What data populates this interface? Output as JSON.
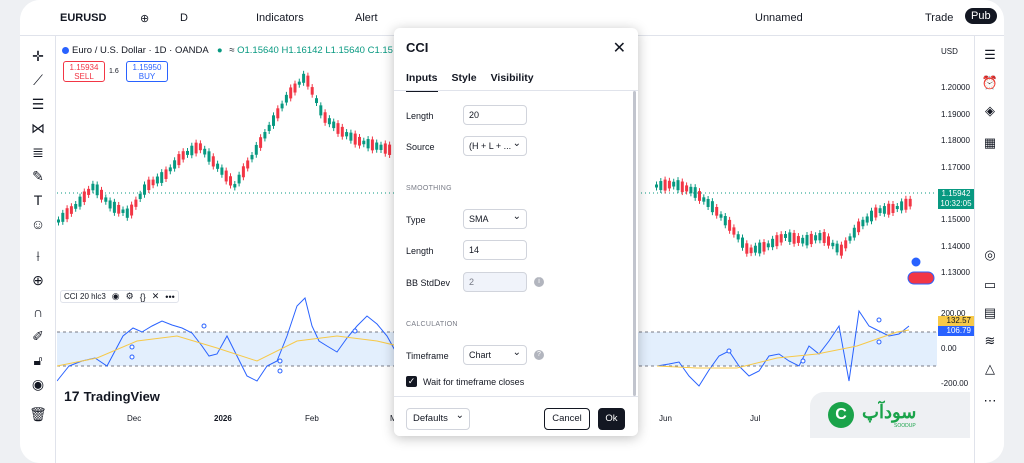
{
  "topbar": {
    "symbol": "EURUSD",
    "interval": "D",
    "indicators_label": "Indicators",
    "alert_label": "Alert",
    "layout_label": "Unnamed",
    "trade_label": "Trade",
    "publish_label": "Pub"
  },
  "legend": {
    "title": "Euro / U.S. Dollar · 1D · OANDA",
    "o": "O1.15640",
    "h": "H1.16142",
    "l": "L1.15640",
    "c": "C1.15"
  },
  "trade": {
    "sell_price": "1.15934",
    "sell_label": "SELL",
    "spread": "1.6",
    "buy_price": "1.15950",
    "buy_label": "BUY"
  },
  "price_axis": {
    "currency": "USD",
    "labels": [
      "1.20000",
      "1.19000",
      "1.18000",
      "1.17000",
      "1.15000",
      "1.14000",
      "1.13000"
    ],
    "last_price": "1.15942",
    "countdown": "10:32:05",
    "cci_labels": [
      "200.00",
      "0.00",
      "-200.00"
    ],
    "cci_value1": "132.57",
    "cci_value2": "106.79"
  },
  "time_axis": [
    "Dec",
    "2026",
    "Feb",
    "M",
    "Jun",
    "Jul"
  ],
  "cci_legend": "CCI 20 hlc3",
  "brand": "TradingView",
  "dialog": {
    "title": "CCI",
    "tabs": [
      "Inputs",
      "Style",
      "Visibility"
    ],
    "length_label": "Length",
    "length_value": "20",
    "source_label": "Source",
    "source_value": "(H + L + ...",
    "smoothing_header": "SMOOTHING",
    "type_label": "Type",
    "type_value": "SMA",
    "smooth_length_label": "Length",
    "smooth_length_value": "14",
    "bb_label": "BB StdDev",
    "bb_value": "2",
    "calculation_header": "CALCULATION",
    "timeframe_label": "Timeframe",
    "timeframe_value": "Chart",
    "wait_label": "Wait for timeframe closes",
    "defaults_label": "Defaults",
    "cancel_label": "Cancel",
    "ok_label": "Ok"
  },
  "watermark": {
    "text": "سودآپ",
    "sub": "SOODUP"
  },
  "colors": {
    "up": "#089981",
    "down": "#f23645",
    "accent": "#2962ff",
    "cci_line": "#2962ff",
    "cci_ma": "#f7c948",
    "watermark": "#1aa34a"
  }
}
